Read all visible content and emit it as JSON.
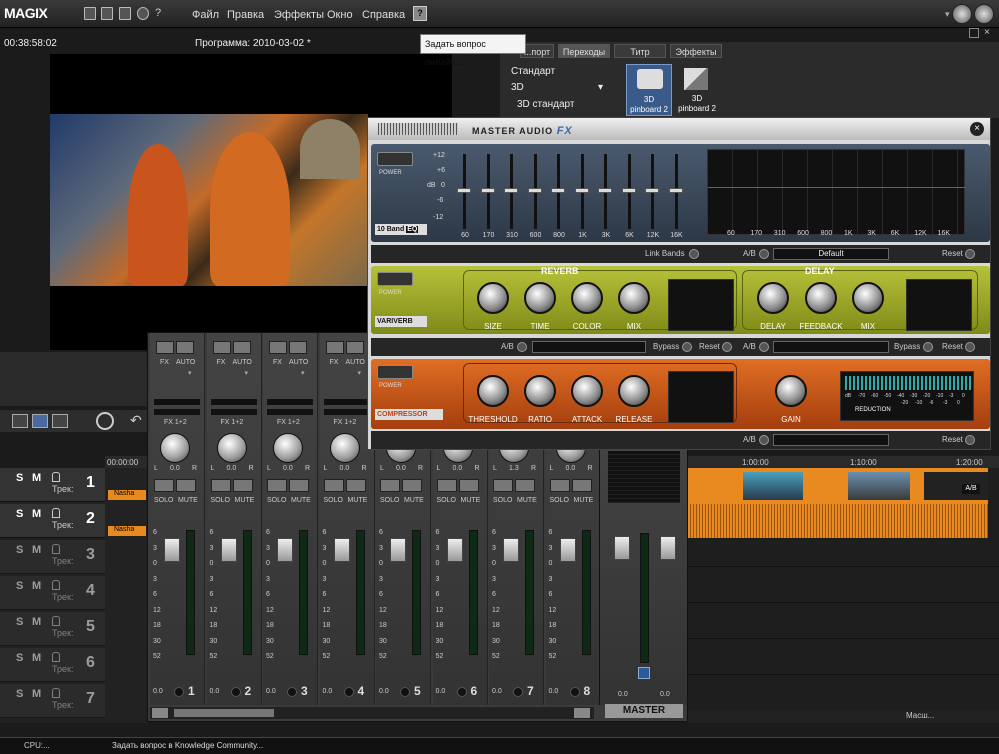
{
  "menubar": {
    "logo": "MAGIX",
    "items": [
      "Файл",
      "Правка",
      "Эффекты",
      "Окно",
      "Справка"
    ]
  },
  "tooltip": "Задать вопрос онлайн...",
  "preview": {
    "timecode": "00:38:58:02",
    "program": "Программа: 2010-03-02 *"
  },
  "browser": {
    "tabs": [
      "...порт",
      "Переходы",
      "Титр",
      "Эффекты"
    ],
    "category": "Стандарт",
    "subcategory": "3D",
    "item_selected": "3D стандарт",
    "items": [
      {
        "line1": "3D",
        "line2": "pinboard 2"
      },
      {
        "line1": "3D",
        "line2": "pinboard 2"
      }
    ]
  },
  "fx": {
    "title": "MASTER AUDIO",
    "title_fx": "FX",
    "eq": {
      "label": "10 Band",
      "sub": "EQ",
      "power": "POWER",
      "db_label": "dB",
      "db": [
        "+12",
        "+6",
        "0",
        "-6",
        "-12"
      ],
      "bands": [
        "60",
        "170",
        "310",
        "600",
        "800",
        "1K",
        "3K",
        "6K",
        "12K",
        "16K"
      ],
      "graph_bands": [
        "60",
        "170",
        "310",
        "600",
        "800",
        "1K",
        "3K",
        "6K",
        "12K",
        "16K"
      ],
      "link": "Link Bands",
      "ab": "A/B",
      "preset": "Default",
      "reset": "Reset"
    },
    "reverb": {
      "name": "VARIVERB",
      "title": "REVERB",
      "knobs": [
        "SIZE",
        "TIME",
        "COLOR",
        "MIX"
      ],
      "ab": "A/B",
      "bypass": "Bypass",
      "reset": "Reset",
      "power": "POWER"
    },
    "delay": {
      "title": "DELAY",
      "knobs": [
        "DELAY",
        "FEEDBACK",
        "MIX"
      ],
      "ab": "A/B",
      "bypass": "Bypass",
      "reset": "Reset"
    },
    "compressor": {
      "name": "COMPRESSOR",
      "knobs": [
        "THRESHOLD",
        "RATIO",
        "ATTACK",
        "RELEASE"
      ],
      "gain": "GAIN",
      "ab": "A/B",
      "reset": "Reset",
      "power": "POWER",
      "reduction": "REDUCTION",
      "scale": [
        "dB",
        "-70",
        "-60",
        "-50",
        "-40",
        "-30",
        "-20",
        "-10",
        "-3",
        "0"
      ],
      "scale2": [
        "-20",
        "-10",
        "-6",
        "-3",
        "0"
      ]
    }
  },
  "mixer": {
    "fx": "FX",
    "auto": "AUTO",
    "fx12": "FX 1+2",
    "solo": "SOLO",
    "mute": "MUTE",
    "l": "L",
    "r": "R",
    "pan": "0.0",
    "pan7": "1.3",
    "vol": "0.0",
    "scale": [
      "6",
      "3",
      "0",
      "3",
      "6",
      "12",
      "18",
      "30",
      "52"
    ],
    "strips": [
      "1",
      "2",
      "3",
      "4",
      "5",
      "6",
      "7",
      "8"
    ],
    "master": "MASTER"
  },
  "tracks": {
    "items": [
      {
        "num": "1",
        "label": "Трек:",
        "clip": "Nasha"
      },
      {
        "num": "2",
        "label": "Трек:",
        "clip": "Nasha"
      },
      {
        "num": "3",
        "label": "Трек:"
      },
      {
        "num": "4",
        "label": "Трек:"
      },
      {
        "num": "5",
        "label": "Трек:"
      },
      {
        "num": "6",
        "label": "Трек:"
      },
      {
        "num": "7",
        "label": "Трек:"
      }
    ],
    "s": "S",
    "m": "M"
  },
  "timeline": {
    "ticks": [
      "00:00:00",
      "1:00:00",
      "1:10:00",
      "1:20:00"
    ],
    "ab": "A/B",
    "zoom": "Масш..."
  },
  "status": {
    "cpu": "CPU:...",
    "hint": "Задать вопрос в Knowledge Community..."
  }
}
